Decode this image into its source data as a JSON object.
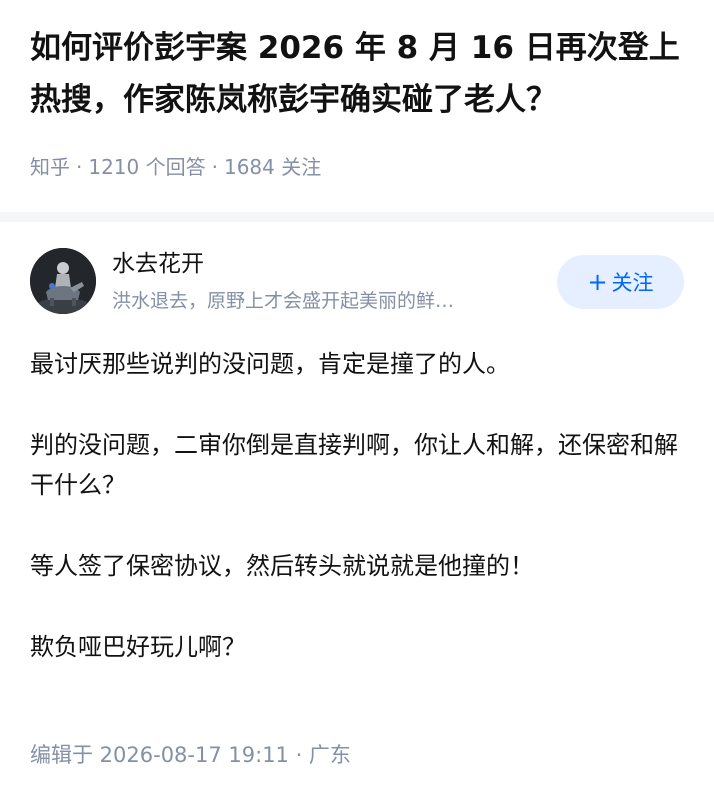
{
  "question": {
    "title": "如何评价彭宇案 2026 年 8 月 16 日再次登上热搜，作家陈岚称彭宇确实碰了老人？",
    "source": "知乎",
    "answers_count": "1210 个回答",
    "followers": "1684 关注",
    "separator": "·"
  },
  "answer": {
    "author": {
      "name": "水去花开",
      "bio": "洪水退去，原野上才会盛开起美丽的鲜…",
      "avatar_icon": "avatar-rider-icon"
    },
    "follow_button": {
      "icon": "+",
      "label": "关注"
    },
    "paragraphs": [
      "最讨厌那些说判的没问题，肯定是撞了的人。",
      "判的没问题，二审你倒是直接判啊，你让人和解，还保密和解干什么？",
      "等人签了保密协议，然后转头就说就是他撞的！",
      "欺负哑巴好玩儿啊？"
    ],
    "edit_info": "编辑于 2026-08-17 19:11 · 广东"
  },
  "colors": {
    "primary": "#0066ff",
    "follow_bg": "#e5efff",
    "meta_text": "#8590a6",
    "body_text": "#121212",
    "page_bg": "#f5f6f7"
  }
}
